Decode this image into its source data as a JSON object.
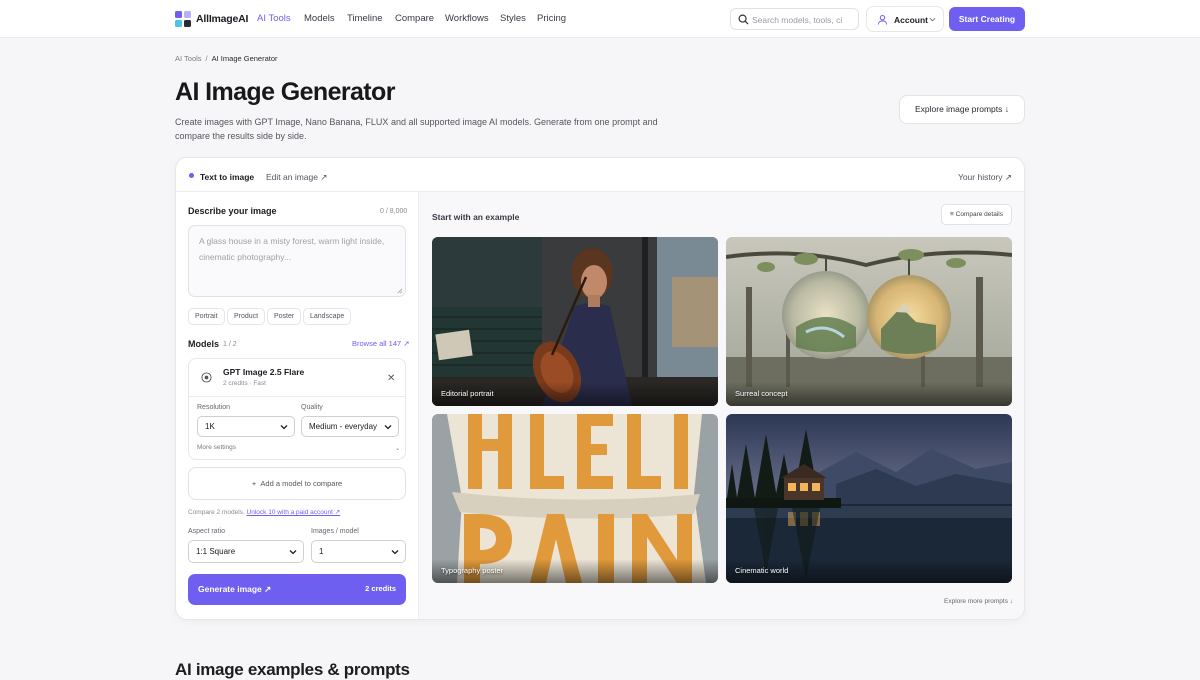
{
  "nav": {
    "brand": "AllImageAI",
    "links": [
      "AI Tools",
      "Models",
      "Timeline",
      "Compare",
      "Workflows",
      "Styles",
      "Pricing"
    ],
    "search_placeholder": "Search models, tools, ci",
    "account_label": "Account",
    "cta_label": "Start Creating"
  },
  "breadcrumb": {
    "root": "AI Tools",
    "separator": "/",
    "current": "AI Image Generator"
  },
  "hero": {
    "title": "AI Image Generator",
    "subtitle": "Create images with GPT Image, Nano Banana, FLUX and all supported image AI models. Generate from one prompt and compare the results side by side.",
    "explore_label": "Explore image prompts ↓"
  },
  "tabs": {
    "text_to_image": "Text to image",
    "edit_image": "Edit an image ↗",
    "history": "Your history ↗"
  },
  "form": {
    "describe_label": "Describe your image",
    "char_count": "0 / 8,000",
    "prompt_placeholder": "A glass house in a misty forest, warm light inside, cinematic photography...",
    "chips": [
      "Portrait",
      "Product",
      "Poster",
      "Landscape"
    ],
    "models_label": "Models",
    "models_count": "1 / 2",
    "browse_all": "Browse all 147 ↗",
    "model": {
      "name": "GPT Image 2.5 Flare",
      "meta": "2 credits · Fast",
      "resolution_label": "Resolution",
      "resolution_value": "1K",
      "quality_label": "Quality",
      "quality_value": "Medium - everyday",
      "more_settings": "More settings"
    },
    "add_model": "Add a model to compare",
    "compare_note": "Compare 2 models.",
    "unlock_link": "Unlock 10 with a paid account ↗",
    "aspect_label": "Aspect ratio",
    "aspect_value": "1:1 Square",
    "images_label": "Images / model",
    "images_value": "1",
    "generate_label": "Generate image ↗",
    "generate_credits": "2 credits"
  },
  "examples": {
    "title": "Start with an example",
    "compare_details": "Compare details",
    "tiles": [
      "Editorial portrait",
      "Surreal concept",
      "Typography poster",
      "Cinematic world"
    ],
    "more": "Explore more prompts ↓"
  },
  "section_heading": "AI image examples & prompts",
  "colors": {
    "accent": "#6e5ff0",
    "page_bg": "#f6f6f8"
  }
}
